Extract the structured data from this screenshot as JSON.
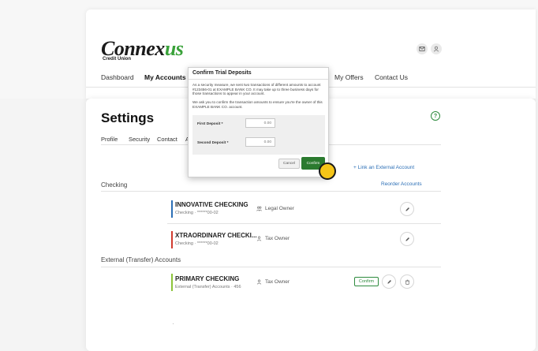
{
  "brand": {
    "name_main": "Connex",
    "name_accent": "us",
    "subtitle": "Credit Union"
  },
  "header": {
    "icons": [
      "mail-icon",
      "user-icon"
    ]
  },
  "nav": {
    "items": [
      "Dashboard",
      "My Accounts",
      "My Offers",
      "Contact Us"
    ],
    "active": "My Accounts"
  },
  "settings": {
    "title": "Settings",
    "tabs": [
      "Profile",
      "Security",
      "Contact",
      "A"
    ],
    "help_icon": "?",
    "link_external": "+ Link an External Account",
    "reorder": "Reorder Accounts"
  },
  "sections": {
    "checking": {
      "label": "Checking",
      "accounts": [
        {
          "name": "INNOVATIVE CHECKING",
          "sub": "Checking · ******00-02",
          "owner": "Legal Owner",
          "owner_icon": "group-icon",
          "color": "#2c6fb6"
        },
        {
          "name": "XTRAORDINARY CHECKI...",
          "sub": "Checking · ******00-02",
          "owner": "Tax Owner",
          "owner_icon": "person-icon",
          "color": "#d13b2f"
        }
      ]
    },
    "external": {
      "label": "External (Transfer) Accounts",
      "accounts": [
        {
          "name": "PRIMARY CHECKING",
          "sub": "External (Transfer) Accounts · 456",
          "owner": "Tax Owner",
          "owner_icon": "person-icon",
          "color": "#8cc43a",
          "confirm_label": "Confirm"
        }
      ]
    }
  },
  "modal": {
    "title": "Confirm Trial Deposits",
    "text1": "As a security measure, we sent two transactions of different amounts to account #123456-01 at EXAMPLE BANK CO. It may take up to three business days for those transactions to appear in your account.",
    "text2": "We ask you to confirm the transaction amounts to ensure you're the owner of this EXAMPLE BANK CO. account.",
    "first_label": "First Deposit *",
    "first_value": "0.00",
    "second_label": "Second Deposit *",
    "second_value": "0.00",
    "cancel": "Cancel",
    "confirm": "Confirm"
  },
  "colors": {
    "accent_green": "#2b7a2f",
    "link_blue": "#2c6fb6",
    "cursor": "#f5c518"
  }
}
